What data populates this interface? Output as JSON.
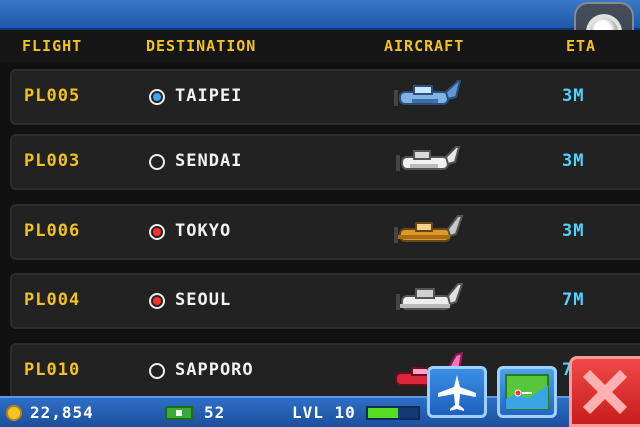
{
  "columns": {
    "flight": "FLIGHT",
    "destination": "DESTINATION",
    "aircraft": "AIRCRAFT",
    "eta": "ETA"
  },
  "flights": [
    {
      "flight": "PL005",
      "destination": "TAIPEI",
      "dot_color": "#3aa6ff",
      "aircraft_icon": "blue-propeller-plane-icon",
      "eta": "3M"
    },
    {
      "flight": "PL003",
      "destination": "SENDAI",
      "dot_color": "#222222",
      "aircraft_icon": "white-propeller-plane-icon",
      "eta": "3M"
    },
    {
      "flight": "PL006",
      "destination": "TOKYO",
      "dot_color": "#ff3030",
      "aircraft_icon": "orange-propeller-plane-icon",
      "eta": "3M"
    },
    {
      "flight": "PL004",
      "destination": "SEOUL",
      "dot_color": "#ff3030",
      "aircraft_icon": "white-propeller-plane-icon",
      "eta": "7M"
    },
    {
      "flight": "PL010",
      "destination": "SAPPORO",
      "dot_color": "#222222",
      "aircraft_icon": "pink-red-plane-icon",
      "eta": "7"
    }
  ],
  "status": {
    "coins": "22,854",
    "bux": "52",
    "level": "LVL 10",
    "xp_progress": 0.6
  },
  "colors": {
    "header_text": "#f4c21e",
    "flight_text": "#f4c21e",
    "eta_text": "#4fd4ff",
    "bar_blue": "#2f6fc6",
    "close_red": "#e03030"
  }
}
